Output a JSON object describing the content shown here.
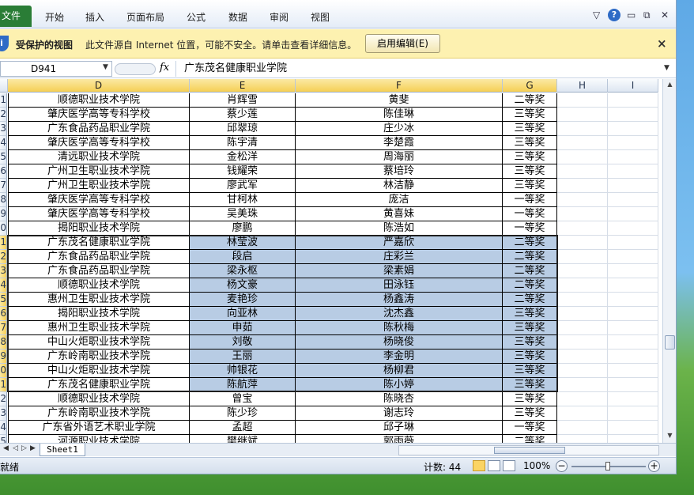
{
  "ribbon": {
    "file_label": "文件",
    "tabs": [
      "开始",
      "插入",
      "页面布局",
      "公式",
      "数据",
      "审阅",
      "视图"
    ],
    "help_label": "?"
  },
  "protected_view": {
    "title": "受保护的视图",
    "message": "此文件源自 Internet 位置，可能不安全。请单击查看详细信息。",
    "button": "启用编辑(E)",
    "close": "×"
  },
  "formula_bar": {
    "name_box": "D941",
    "fx": "fx",
    "value": "广东茂名健康职业学院"
  },
  "columns": [
    "D",
    "E",
    "F",
    "G",
    "H",
    "I"
  ],
  "row_numbers": [
    "1",
    "2",
    "3",
    "4",
    "5",
    "6",
    "7",
    "8",
    "9",
    "0",
    "1",
    "2",
    "3",
    "4",
    "5",
    "6",
    "7",
    "8",
    "9",
    "0",
    "1",
    "2",
    "3",
    "4",
    "5"
  ],
  "rows": [
    [
      "顺德职业技术学院",
      "肖辉雪",
      "黄斐",
      "二等奖"
    ],
    [
      "肇庆医学高等专科学校",
      "蔡少莲",
      "陈佳琳",
      "三等奖"
    ],
    [
      "广东食品药品职业学院",
      "邱翠琼",
      "庄少冰",
      "三等奖"
    ],
    [
      "肇庆医学高等专科学校",
      "陈宇清",
      "李楚霞",
      "三等奖"
    ],
    [
      "清远职业技术学院",
      "金松洋",
      "周海丽",
      "三等奖"
    ],
    [
      "广州卫生职业技术学院",
      "钱耀荣",
      "蔡培玲",
      "三等奖"
    ],
    [
      "广州卫生职业技术学院",
      "廖武军",
      "林洁静",
      "三等奖"
    ],
    [
      "肇庆医学高等专科学校",
      "甘柯林",
      "庞洁",
      "一等奖"
    ],
    [
      "肇庆医学高等专科学校",
      "吴美珠",
      "黄喜妹",
      "一等奖"
    ],
    [
      "揭阳职业技术学院",
      "廖鹏",
      "陈浩如",
      "一等奖"
    ],
    [
      "广东茂名健康职业学院",
      "林莹波",
      "严嘉欣",
      "二等奖"
    ],
    [
      "广东食品药品职业学院",
      "段启",
      "庄彩兰",
      "二等奖"
    ],
    [
      "广东食品药品职业学院",
      "梁永枢",
      "梁素娟",
      "二等奖"
    ],
    [
      "顺德职业技术学院",
      "杨文豪",
      "田泳钰",
      "二等奖"
    ],
    [
      "惠州卫生职业技术学院",
      "麦艳珍",
      "杨鑫涛",
      "二等奖"
    ],
    [
      "揭阳职业技术学院",
      "向亚林",
      "沈杰鑫",
      "三等奖"
    ],
    [
      "惠州卫生职业技术学院",
      "申茹",
      "陈秋梅",
      "三等奖"
    ],
    [
      "中山火炬职业技术学院",
      "刘敬",
      "杨晓俊",
      "三等奖"
    ],
    [
      "广东岭南职业技术学院",
      "王丽",
      "李金明",
      "三等奖"
    ],
    [
      "中山火炬职业技术学院",
      "帅银花",
      "杨柳君",
      "三等奖"
    ],
    [
      "广东茂名健康职业学院",
      "陈航萍",
      "陈小婷",
      "三等奖"
    ],
    [
      "顺德职业技术学院",
      "曾宝",
      "陈晓杏",
      "三等奖"
    ],
    [
      "广东岭南职业技术学院",
      "陈少珍",
      "谢志玲",
      "三等奖"
    ],
    [
      "广东省外语艺术职业学院",
      "孟超",
      "邱子琳",
      "一等奖"
    ],
    [
      "河源职业技术学院",
      "樊继斌",
      "郭雨薇",
      "二等奖"
    ]
  ],
  "selection": {
    "first_row_index": 10,
    "last_row_index": 20
  },
  "sheet_tabs": [
    "Sheet1"
  ],
  "status": {
    "ready": "就绪",
    "count": "计数: 44",
    "zoom": "100%"
  },
  "colors": {
    "selection": "#b8cce4",
    "header_selected": "#f5cf55",
    "file_tab": "#2a7d36",
    "protected_bar": "#fdf1b0"
  }
}
